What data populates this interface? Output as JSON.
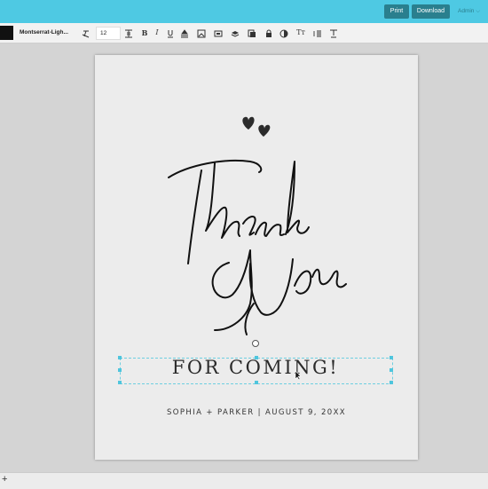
{
  "header": {
    "print_label": "Print",
    "download_label": "Download",
    "admin_label": "Admin ⌵"
  },
  "toolbar": {
    "font_name": "Montserrat-Ligh...",
    "font_size": "12",
    "bold_label": "B",
    "italic_label": "I",
    "text_style_label": "Tт",
    "color_swatch": "#111111"
  },
  "card": {
    "script_line_1": "Thank",
    "script_line_2": "You",
    "subtitle": "FOR COMING!",
    "names_date": "SOPHIA + PARKER | AUGUST 9, 20XX"
  },
  "bottom": {
    "add_label": "+"
  },
  "colors": {
    "accent": "#4ec9e3",
    "button": "#2a7f8e",
    "selection": "#4fc5dd"
  }
}
